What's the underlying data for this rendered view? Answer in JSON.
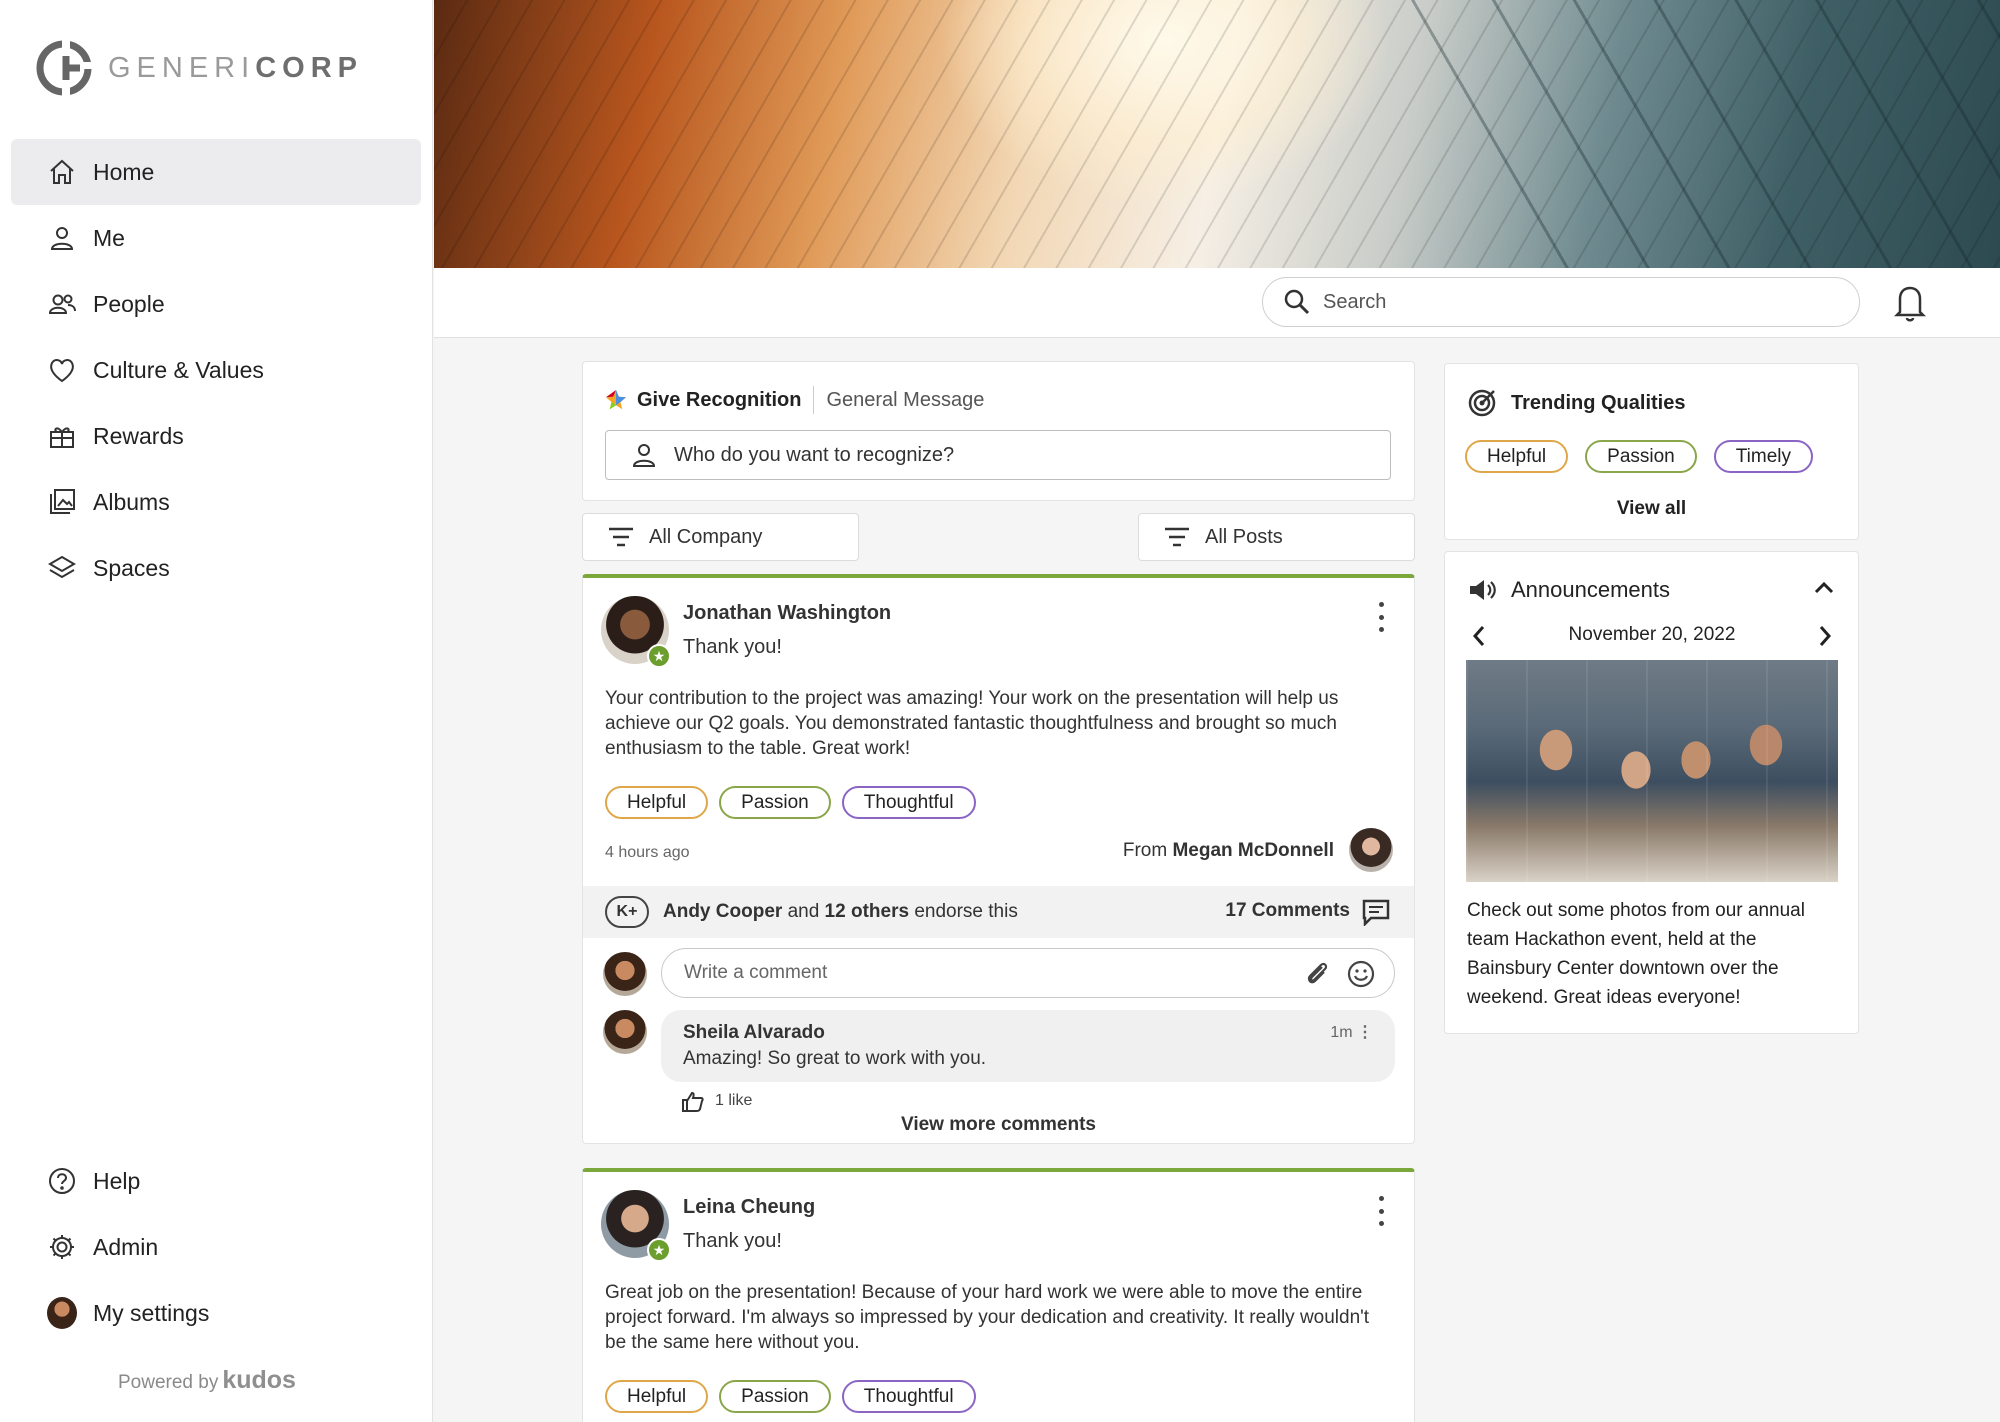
{
  "brand": {
    "logo_text_light": "GENERI",
    "logo_text_bold": "CORP",
    "powered_by": "Powered by",
    "powered_brand": "kudos"
  },
  "sidebar": {
    "items": [
      {
        "label": "Home",
        "icon": "home-icon"
      },
      {
        "label": "Me",
        "icon": "user-icon"
      },
      {
        "label": "People",
        "icon": "people-icon"
      },
      {
        "label": "Culture & Values",
        "icon": "heart-icon"
      },
      {
        "label": "Rewards",
        "icon": "gift-icon"
      },
      {
        "label": "Albums",
        "icon": "album-icon"
      },
      {
        "label": "Spaces",
        "icon": "layers-icon"
      }
    ],
    "bottom": [
      {
        "label": "Help",
        "icon": "help-icon"
      },
      {
        "label": "Admin",
        "icon": "gear-icon"
      },
      {
        "label": "My settings",
        "icon": "avatar"
      }
    ]
  },
  "topbar": {
    "search_placeholder": "Search"
  },
  "recognition": {
    "tab_active": "Give Recognition",
    "tab_other": "General Message",
    "input_placeholder": "Who do you want to recognize?"
  },
  "filters": {
    "scope": "All Company",
    "posts": "All Posts"
  },
  "posts": [
    {
      "author": "Jonathan Washington",
      "subtitle": "Thank you!",
      "body": "Your contribution to the project was amazing! Your work on the presentation will help us achieve our Q2 goals. You demonstrated fantastic thoughtfulness and brought so much enthusiasm to the table. Great work!",
      "tags": [
        "Helpful",
        "Passion",
        "Thoughtful"
      ],
      "time": "4 hours ago",
      "from_prefix": "From",
      "from_name": "Megan McDonnell",
      "kplus": "K+",
      "endorse_name": "Andy Cooper",
      "endorse_and": "and",
      "endorse_others": "12 others",
      "endorse_suffix": "endorse this",
      "comments_count": "17 Comments",
      "comment_placeholder": "Write a comment",
      "reply": {
        "name": "Sheila Alvarado",
        "text": "Amazing! So great to work with you.",
        "time": "1m",
        "likes": "1 like"
      },
      "view_more": "View more comments"
    },
    {
      "author": "Leina Cheung",
      "subtitle": "Thank you!",
      "body": "Great job on the presentation! Because of your hard work we were able to move the entire project forward. I'm always so impressed by your dedication and creativity. It really wouldn't be the same here without you.",
      "tags": [
        "Helpful",
        "Passion",
        "Thoughtful"
      ]
    }
  ],
  "trending": {
    "title": "Trending Qualities",
    "chips": [
      "Helpful",
      "Passion",
      "Timely"
    ],
    "view_all": "View all"
  },
  "announcements": {
    "title": "Announcements",
    "date": "November 20, 2022",
    "text": "Check out some photos from our annual team Hackathon event, held at the Bainsbury Center downtown over the weekend. Great ideas everyone!"
  },
  "colors": {
    "accent_green": "#7aa83a",
    "chip_orange": "#e0a64a",
    "chip_green": "#8aa64a",
    "chip_purple": "#8a65c4"
  }
}
